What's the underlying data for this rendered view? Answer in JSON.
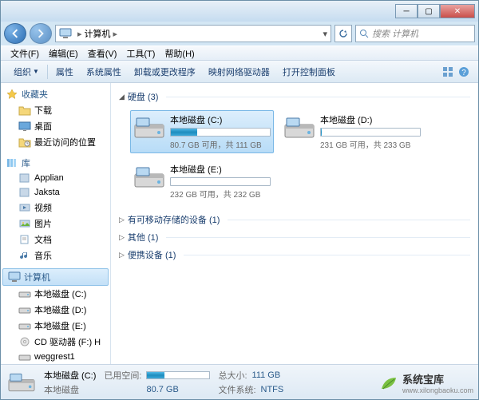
{
  "nav": {
    "breadcrumb": "计算机",
    "refresh_hint": "↻"
  },
  "search": {
    "placeholder": "搜索 计算机"
  },
  "menu": {
    "file": "文件(F)",
    "edit": "编辑(E)",
    "view": "查看(V)",
    "tools": "工具(T)",
    "help": "帮助(H)"
  },
  "toolbar": {
    "organize": "组织",
    "properties": "属性",
    "sys_properties": "系统属性",
    "uninstall": "卸载或更改程序",
    "map_drive": "映射网络驱动器",
    "control_panel": "打开控制面板"
  },
  "sidebar": {
    "favorites": {
      "label": "收藏夹",
      "items": [
        "下载",
        "桌面",
        "最近访问的位置"
      ]
    },
    "libraries": {
      "label": "库",
      "items": [
        "Applian",
        "Jaksta",
        "视频",
        "图片",
        "文档",
        "音乐"
      ]
    },
    "computer": {
      "label": "计算机",
      "items": [
        "本地磁盘 (C:)",
        "本地磁盘 (D:)",
        "本地磁盘 (E:)",
        "CD 驱动器 (F:) H",
        "weggrest1"
      ]
    }
  },
  "sections": {
    "hdd": {
      "label": "硬盘 (3)",
      "expanded": true
    },
    "removable": {
      "label": "有可移动存储的设备 (1)",
      "expanded": false
    },
    "other": {
      "label": "其他 (1)",
      "expanded": false
    },
    "portable": {
      "label": "便携设备 (1)",
      "expanded": false
    }
  },
  "drives": [
    {
      "name": "本地磁盘 (C:)",
      "stat": "80.7 GB 可用，共 111 GB",
      "fill_pct": 27,
      "selected": true
    },
    {
      "name": "本地磁盘 (D:)",
      "stat": "231 GB 可用，共 233 GB",
      "fill_pct": 1,
      "selected": false
    },
    {
      "name": "本地磁盘 (E:)",
      "stat": "232 GB 可用，共 232 GB",
      "fill_pct": 0,
      "selected": false
    }
  ],
  "status": {
    "title": "本地磁盘 (C:)",
    "subtitle": "本地磁盘",
    "used_label": "已用空间:",
    "used_val": "80.7 GB",
    "total_label": "总大小:",
    "total_val": "111 GB",
    "fs_label": "文件系统:",
    "fs_val": "NTFS",
    "fill_pct": 27
  },
  "watermark": {
    "cn": "系统宝库",
    "url": "www.xilongbaoku.com"
  }
}
